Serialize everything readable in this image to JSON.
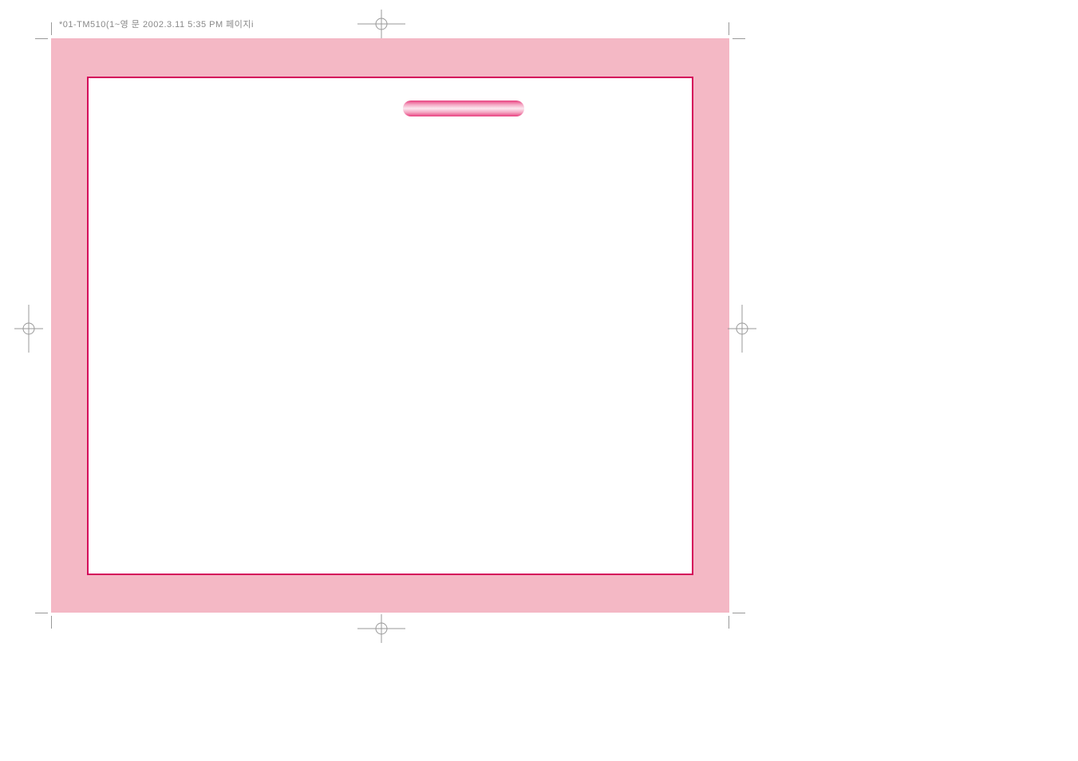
{
  "header": {
    "text": "*01-TM510(1~영 문  2002.3.11 5:35 PM  페이지i"
  }
}
